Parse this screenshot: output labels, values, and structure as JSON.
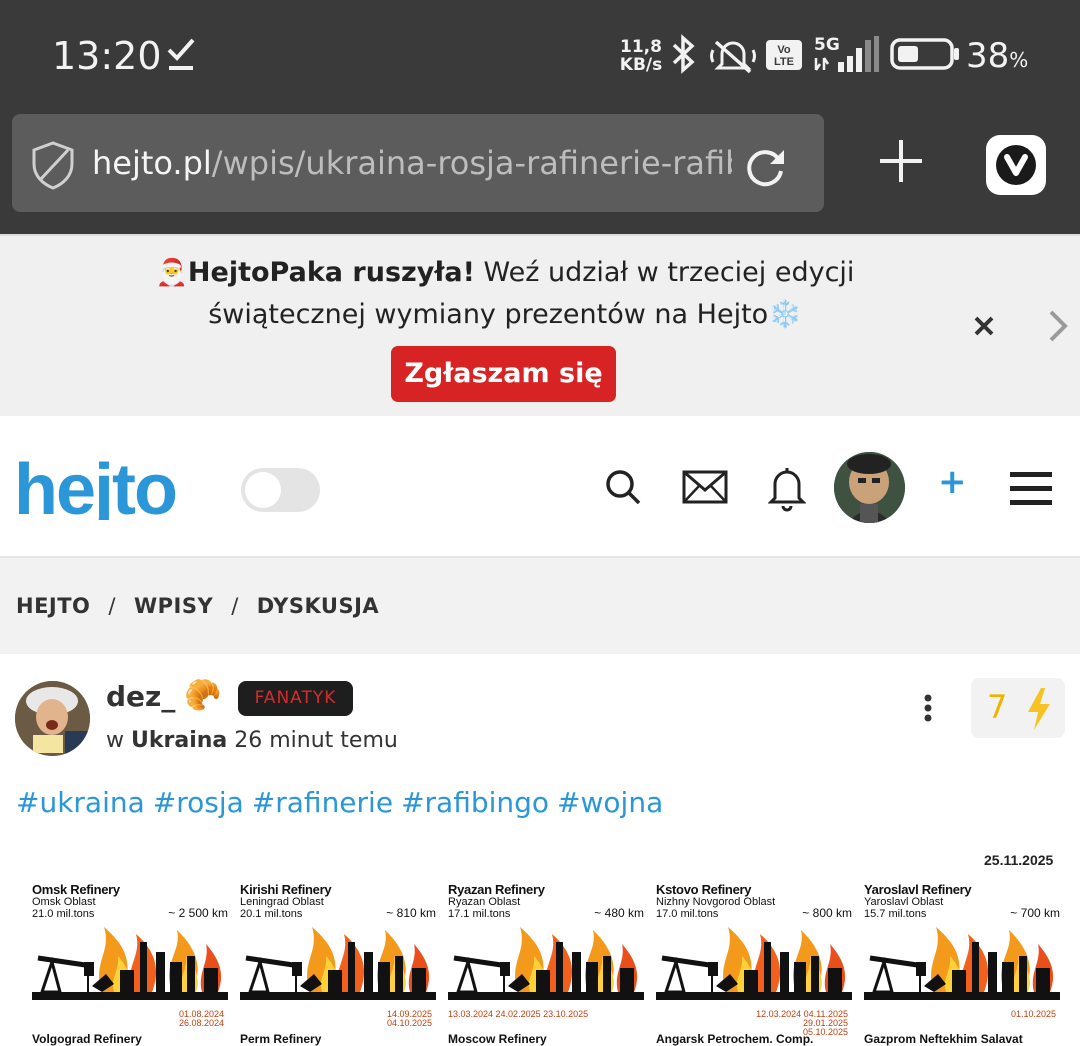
{
  "status": {
    "time": "13:20",
    "speed_value": "11,8",
    "speed_unit": "KB/s",
    "volte_top": "Vo",
    "volte_bottom": "LTE",
    "network": "5G",
    "battery_pct": "38",
    "battery_unit": "%"
  },
  "browser": {
    "url_host": "hejto.pl",
    "url_path": "/wpis/ukraina-rosja-rafinerie-rafibingo"
  },
  "banner": {
    "santa": "🎅",
    "title": "HejtoPaka ruszyła!",
    "text": " Weź udział w trzeciej edycji świątecznej wymiany prezentów na Hejto",
    "snow": "❄️",
    "button": "Zgłaszam się"
  },
  "header": {
    "logo": "hejto",
    "add": "+"
  },
  "breadcrumb": {
    "items": [
      "HEJTO",
      "WPISY",
      "DYSKUSJA"
    ],
    "separator": "/"
  },
  "post": {
    "author": "dez_",
    "author_emoji": "🥐",
    "badge": "FANATYK",
    "meta_prefix": "w",
    "community": "Ukraina",
    "time_ago": "26 minut temu",
    "votes": "7",
    "tags": [
      "#ukraina",
      "#rosja",
      "#rafinerie",
      "#rafibingo",
      "#wojna"
    ]
  },
  "infographic": {
    "date": "25.11.2025",
    "refineries": [
      {
        "name": "Omsk Refinery",
        "oblast": "Omsk Oblast",
        "capacity": "21.0 mil.tons",
        "distance": "~ 2 500 km",
        "dates": [
          "01.08.2024",
          "26.08.2024"
        ],
        "next_name": "Volgograd Refinery"
      },
      {
        "name": "Kirishi Refinery",
        "oblast": "Leningrad Oblast",
        "capacity": "20.1 mil.tons",
        "distance": "~ 810 km",
        "dates": [
          "14.09.2025",
          "04.10.2025"
        ],
        "next_name": "Perm Refinery"
      },
      {
        "name": "Ryazan Refinery",
        "oblast": "Ryazan Oblast",
        "capacity": "17.1 mil.tons",
        "distance": "~ 480 km",
        "dates": [
          "13.03.2024 24.02.2025 23.10.2025"
        ],
        "next_name": "Moscow Refinery"
      },
      {
        "name": "Kstovo Refinery",
        "oblast": "Nizhny Novgorod Oblast",
        "capacity": "17.0 mil.tons",
        "distance": "~ 800 km",
        "dates": [
          "12.03.2024 04.11.2025",
          "29.01.2025",
          "05.10.2025"
        ],
        "next_name": "Angarsk Petrochem. Comp."
      },
      {
        "name": "Yaroslavl Refinery",
        "oblast": "Yaroslavl Oblast",
        "capacity": "15.7 mil.tons",
        "distance": "~ 700 km",
        "dates": [
          "01.10.2025"
        ],
        "next_name": "Gazprom Neftekhim Salavat"
      }
    ]
  }
}
